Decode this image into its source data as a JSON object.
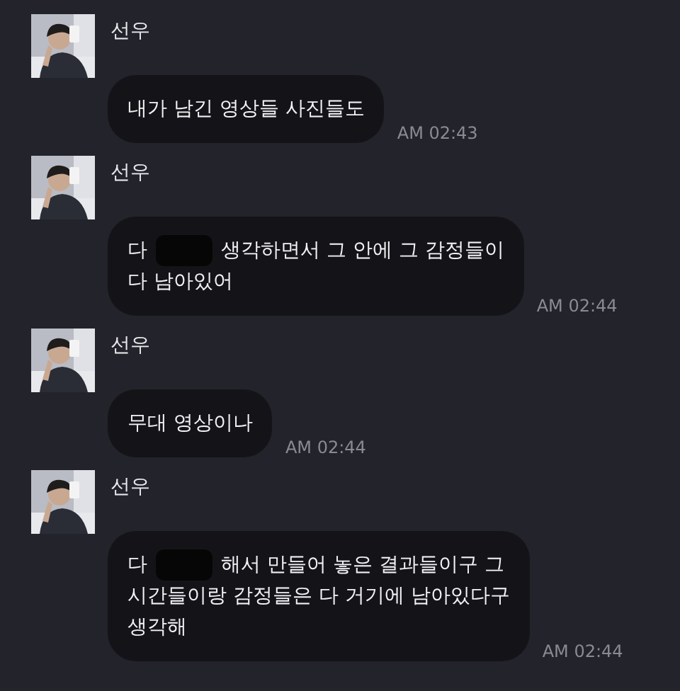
{
  "messages": [
    {
      "sender": "선우",
      "avatar": {
        "kind": "picture"
      },
      "lines": [
        [
          {
            "kind": "text",
            "text": "내가 남긴 영상들 사진들도"
          }
        ]
      ],
      "time": "AM 02:43"
    },
    {
      "sender": "선우",
      "avatar": {
        "kind": "picture"
      },
      "lines": [
        [
          {
            "kind": "text",
            "text": "다"
          },
          {
            "kind": "redaction"
          },
          {
            "kind": "text",
            "text": "생각하면서 그 안에 그 감정들이"
          }
        ],
        [
          {
            "kind": "text",
            "text": "다 남아있어"
          }
        ]
      ],
      "time": "AM 02:44"
    },
    {
      "sender": "선우",
      "avatar": {
        "kind": "picture"
      },
      "lines": [
        [
          {
            "kind": "text",
            "text": "무대 영상이나"
          }
        ]
      ],
      "time": "AM 02:44"
    },
    {
      "sender": "선우",
      "avatar": {
        "kind": "picture"
      },
      "lines": [
        [
          {
            "kind": "text",
            "text": "다"
          },
          {
            "kind": "redaction"
          },
          {
            "kind": "text",
            "text": "해서 만들어 놓은 결과들이구 그"
          }
        ],
        [
          {
            "kind": "text",
            "text": "시간들이랑 감정들은 다 거기에 남아있다구"
          }
        ],
        [
          {
            "kind": "text",
            "text": "생각해"
          }
        ]
      ],
      "time": "AM 02:44"
    }
  ]
}
